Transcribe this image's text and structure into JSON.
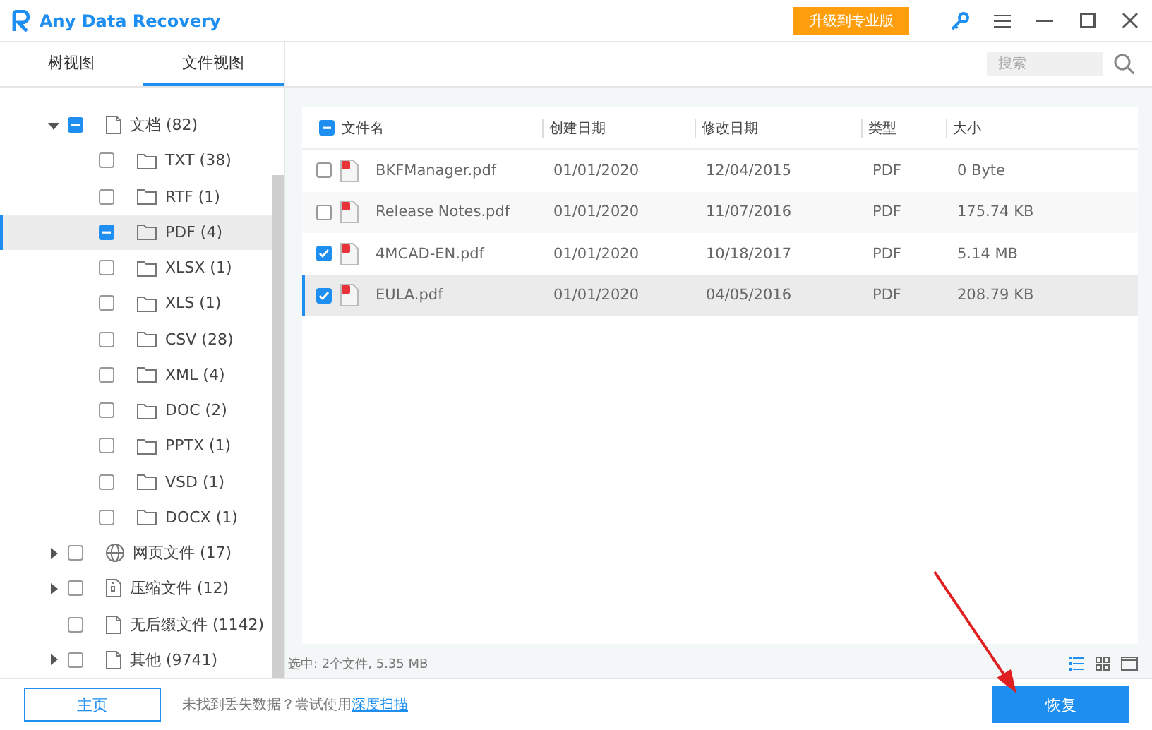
{
  "window": {
    "title": "Any Data Recovery",
    "upgrade_button": "升级到专业版"
  },
  "view_tabs": [
    {
      "label": "树视图",
      "selected": false
    },
    {
      "label": "文件视图",
      "selected": true
    }
  ],
  "tree": [
    {
      "label": "文档 (82)",
      "kind": "file",
      "expandable": true,
      "expanded": true,
      "checked": false,
      "partial": true,
      "selected": false,
      "children": [
        {
          "label": "TXT (38)",
          "kind": "folder",
          "checked": false,
          "partial": false,
          "selected": false
        },
        {
          "label": "RTF (1)",
          "kind": "folder",
          "checked": false,
          "partial": false,
          "selected": false
        },
        {
          "label": "PDF (4)",
          "kind": "folder",
          "checked": false,
          "partial": true,
          "selected": true
        },
        {
          "label": "XLSX (1)",
          "kind": "folder",
          "checked": false,
          "partial": false,
          "selected": false
        },
        {
          "label": "XLS (1)",
          "kind": "folder",
          "checked": false,
          "partial": false,
          "selected": false
        },
        {
          "label": "CSV (28)",
          "kind": "folder",
          "checked": false,
          "partial": false,
          "selected": false
        },
        {
          "label": "XML (4)",
          "kind": "folder",
          "checked": false,
          "partial": false,
          "selected": false
        },
        {
          "label": "DOC (2)",
          "kind": "folder",
          "checked": false,
          "partial": false,
          "selected": false
        },
        {
          "label": "PPTX (1)",
          "kind": "folder",
          "checked": false,
          "partial": false,
          "selected": false
        },
        {
          "label": "VSD (1)",
          "kind": "folder",
          "checked": false,
          "partial": false,
          "selected": false
        },
        {
          "label": "DOCX (1)",
          "kind": "folder",
          "checked": false,
          "partial": false,
          "selected": false
        }
      ]
    },
    {
      "label": "网页文件 (17)",
      "kind": "globe",
      "expandable": true,
      "expanded": false,
      "checked": false,
      "partial": false,
      "selected": false
    },
    {
      "label": "压缩文件 (12)",
      "kind": "archive",
      "expandable": true,
      "expanded": false,
      "checked": false,
      "partial": false,
      "selected": false
    },
    {
      "label": "无后缀文件 (1142)",
      "kind": "file",
      "expandable": false,
      "checked": false,
      "partial": false,
      "selected": false
    },
    {
      "label": "其他 (9741)",
      "kind": "file",
      "expandable": true,
      "expanded": false,
      "checked": false,
      "partial": false,
      "selected": false
    }
  ],
  "search": {
    "placeholder": "搜索"
  },
  "table": {
    "select_all": {
      "checked": false,
      "partial": true
    },
    "columns": [
      "文件名",
      "创建日期",
      "修改日期",
      "类型",
      "大小"
    ],
    "rows": [
      {
        "cells": [
          "BKFManager.pdf",
          "01/01/2020",
          "12/04/2015",
          "PDF",
          "0 Byte"
        ],
        "checked": false,
        "selected": false
      },
      {
        "cells": [
          "Release Notes.pdf",
          "01/01/2020",
          "11/07/2016",
          "PDF",
          "175.74 KB"
        ],
        "checked": false,
        "selected": false
      },
      {
        "cells": [
          "4MCAD-EN.pdf",
          "01/01/2020",
          "10/18/2017",
          "PDF",
          "5.14 MB"
        ],
        "checked": true,
        "selected": false
      },
      {
        "cells": [
          "EULA.pdf",
          "01/01/2020",
          "04/05/2016",
          "PDF",
          "208.79 KB"
        ],
        "checked": true,
        "selected": true
      }
    ]
  },
  "status_bar": {
    "text": "选中: 2个文件, 5.35 MB",
    "view_modes": [
      {
        "kind": "list",
        "selected": true
      },
      {
        "kind": "grid",
        "selected": false
      },
      {
        "kind": "single",
        "selected": false
      }
    ]
  },
  "footer": {
    "home_button": "主页",
    "hint": "未找到丢失数据？尝试使用",
    "hint_link": "深度扫描",
    "recover_button": "恢复"
  }
}
